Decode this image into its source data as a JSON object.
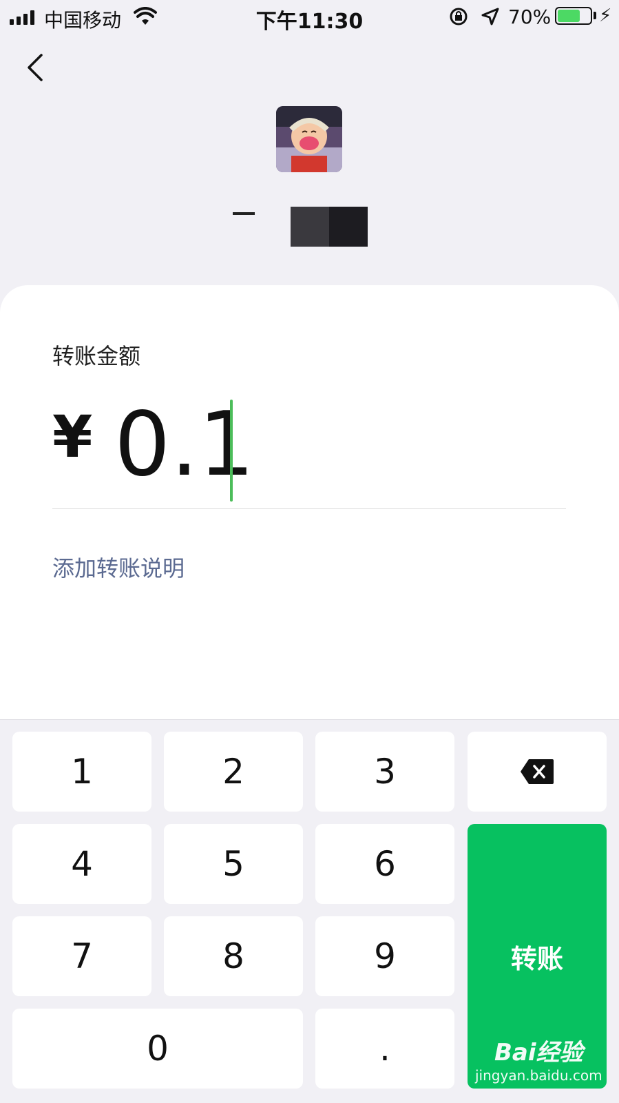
{
  "status_bar": {
    "carrier": "中国移动",
    "time": "下午11:30",
    "battery_percent": "70%",
    "battery_level": 0.7,
    "battery_color": "#4cd964"
  },
  "header": {
    "back_icon": "chevron-left-icon",
    "avatar": "user-avatar"
  },
  "transfer": {
    "amount_label": "转账金额",
    "currency_symbol": "¥",
    "amount_value": "0.1",
    "add_note_label": "添加转账说明",
    "cursor_color": "#4cbd5a"
  },
  "keypad": {
    "keys": [
      "1",
      "2",
      "3",
      "4",
      "5",
      "6",
      "7",
      "8",
      "9",
      "0",
      "."
    ],
    "backspace_icon": "backspace-icon",
    "transfer_label": "转账",
    "transfer_color": "#07c160"
  },
  "watermark": {
    "main": "Bai经验",
    "sub": "jingyan.baidu.com"
  }
}
